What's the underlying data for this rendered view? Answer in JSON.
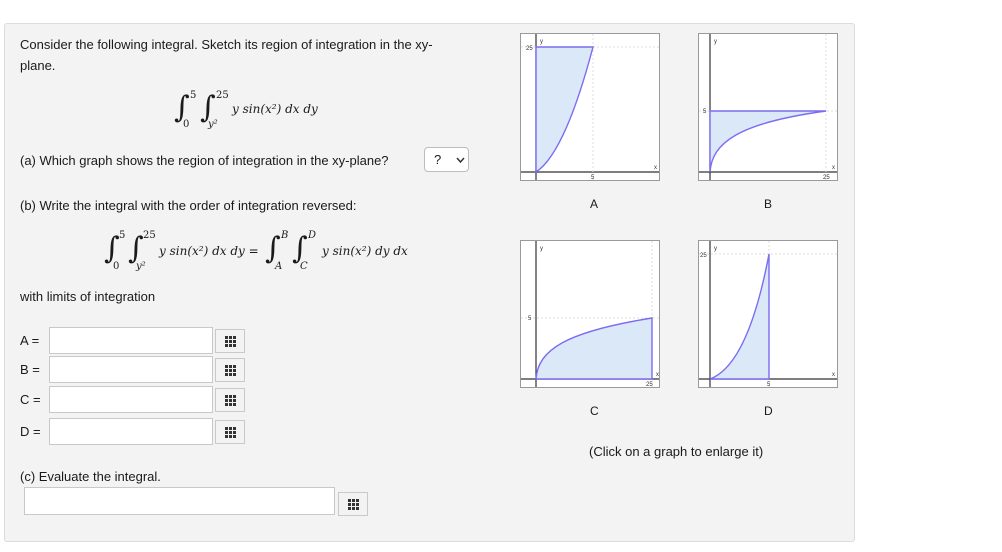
{
  "question": {
    "prompt_line1": "Consider the following integral. Sketch its region of integration in the xy-",
    "prompt_line2": "plane.",
    "integral": {
      "outer_upper": "5",
      "outer_lower": "0",
      "inner_upper": "25",
      "inner_lower": "y²",
      "integrand": "y sin(x²) dx dy"
    }
  },
  "part_a": {
    "text": "(a) Which graph shows the region of integration in the xy-plane?",
    "selected": "?",
    "chevron_icon": "chevron-down-icon"
  },
  "part_b": {
    "text": "(b) Write the integral with the order of integration reversed:",
    "left_integral": {
      "outer_upper": "5",
      "outer_lower": "0",
      "inner_upper": "25",
      "inner_lower": "y²",
      "integrand": "y sin(x²) dx dy ="
    },
    "right_integral": {
      "outer_upper": "B",
      "outer_lower": "A",
      "inner_upper": "D",
      "inner_lower": "C",
      "integrand": "y sin(x²) dy dx"
    },
    "limits_label": "with limits of integration",
    "rows": [
      {
        "label": "A =",
        "value": ""
      },
      {
        "label": "B =",
        "value": ""
      },
      {
        "label": "C =",
        "value": ""
      },
      {
        "label": "D =",
        "value": ""
      }
    ],
    "keypad_icon": "keypad-grid-icon"
  },
  "part_c": {
    "text": "(c) Evaluate the integral.",
    "value": ""
  },
  "graphs": {
    "caption_a": "A",
    "caption_b": "B",
    "caption_c": "C",
    "caption_d": "D",
    "a": {
      "y_tick": "25",
      "x_tick": "5",
      "y_axis": "y",
      "x_axis": "x"
    },
    "b": {
      "y_tick": "5",
      "x_tick": "25",
      "y_axis": "y",
      "x_axis": "x"
    },
    "c": {
      "y_tick": "5",
      "x_tick": "25",
      "y_axis": "y",
      "x_axis": "x"
    },
    "d": {
      "y_tick": "25",
      "x_tick": "5",
      "y_axis": "y",
      "x_axis": "x"
    },
    "fill_color": "#dbe8f8",
    "curve_color": "#7b6cf0",
    "hint": "(Click on a graph to enlarge it)"
  }
}
